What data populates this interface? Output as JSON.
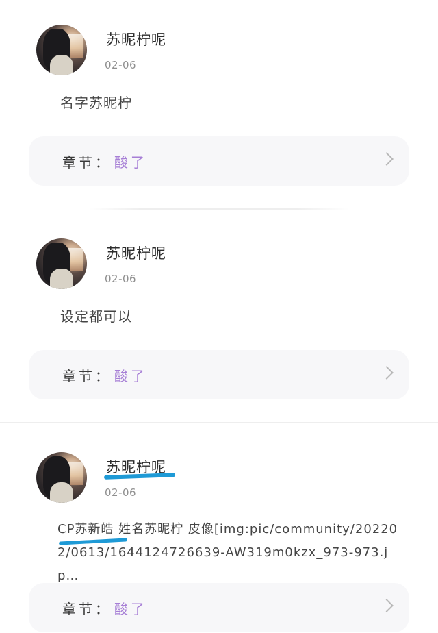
{
  "comments": [
    {
      "username": "苏昵柠呢",
      "date": "02-06",
      "content": "名字苏昵柠",
      "chapter_label": "章节：",
      "chapter_value": "酸了"
    },
    {
      "username": "苏昵柠呢",
      "date": "02-06",
      "content": "设定都可以",
      "chapter_label": "章节：",
      "chapter_value": "酸了"
    },
    {
      "username": "苏昵柠呢",
      "date": "02-06",
      "content": "CP苏新皓 姓名苏昵柠 皮像[img:pic/community/202202/0613/1644124726639-AW319m0kzx_973-973.jp…",
      "chapter_label": "章节：",
      "chapter_value": "酸了"
    }
  ],
  "icons": {
    "chevron": "chevron-right-icon",
    "avatar": "avatar"
  },
  "colors": {
    "chapter_accent": "#a77fd6",
    "annotation_underline": "#1e9ad6",
    "card_background": "#f7f7f9"
  }
}
